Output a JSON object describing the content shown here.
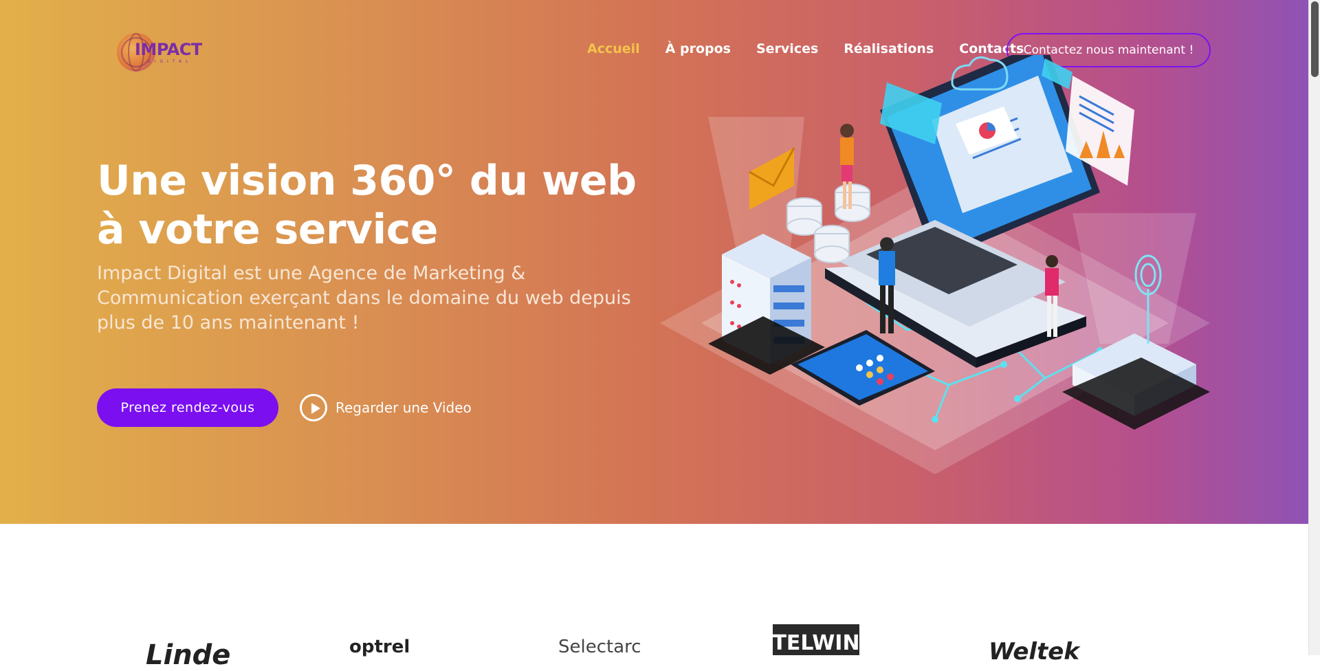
{
  "brand": {
    "logo_text": "IMPACT",
    "logo_sub": "DIGITAL"
  },
  "nav": {
    "items": [
      {
        "label": "Accueil",
        "active": true
      },
      {
        "label": "À propos",
        "active": false
      },
      {
        "label": "Services",
        "active": false
      },
      {
        "label": "Réalisations",
        "active": false
      },
      {
        "label": "Contacts",
        "active": false
      }
    ],
    "cta_label": "Contactez nous maintenant !"
  },
  "hero": {
    "headline": "Une vision 360° du web à votre service",
    "lead": "Impact Digital est une Agence de Marketing & Communication exerçant dans le domaine du web depuis plus de 10 ans maintenant !",
    "primary_button": "Prenez rendez-vous",
    "video_link": "Regarder une Video"
  },
  "partners": {
    "logos": [
      "Linde",
      "optrel",
      "Selectarc",
      "TELWIN",
      "Weltek"
    ]
  },
  "colors": {
    "accent_purple": "#7b0ff0",
    "nav_active": "#f5c34c",
    "hero_gradient_start": "#e2b04a",
    "hero_gradient_end": "#8f53b5"
  }
}
